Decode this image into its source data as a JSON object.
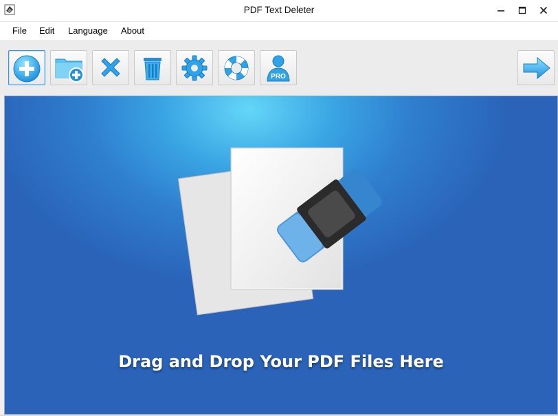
{
  "window": {
    "title": "PDF Text Deleter"
  },
  "menu": {
    "items": [
      {
        "label": "File"
      },
      {
        "label": "Edit"
      },
      {
        "label": "Language"
      },
      {
        "label": "About"
      }
    ]
  },
  "toolbar": {
    "buttons": [
      {
        "icon": "add-file-icon",
        "active": true
      },
      {
        "icon": "add-folder-icon"
      },
      {
        "icon": "remove-icon"
      },
      {
        "icon": "trash-icon"
      },
      {
        "icon": "gear-icon"
      },
      {
        "icon": "lifebuoy-icon"
      },
      {
        "icon": "pro-user-icon",
        "badge": "PRO"
      },
      {
        "icon": "next-arrow-icon"
      }
    ]
  },
  "dropzone": {
    "text": "Drag and Drop Your PDF Files Here"
  },
  "colors": {
    "accent": "#2f9be4",
    "drop_top": "#64d6f8",
    "drop_bottom": "#2a63b8"
  }
}
